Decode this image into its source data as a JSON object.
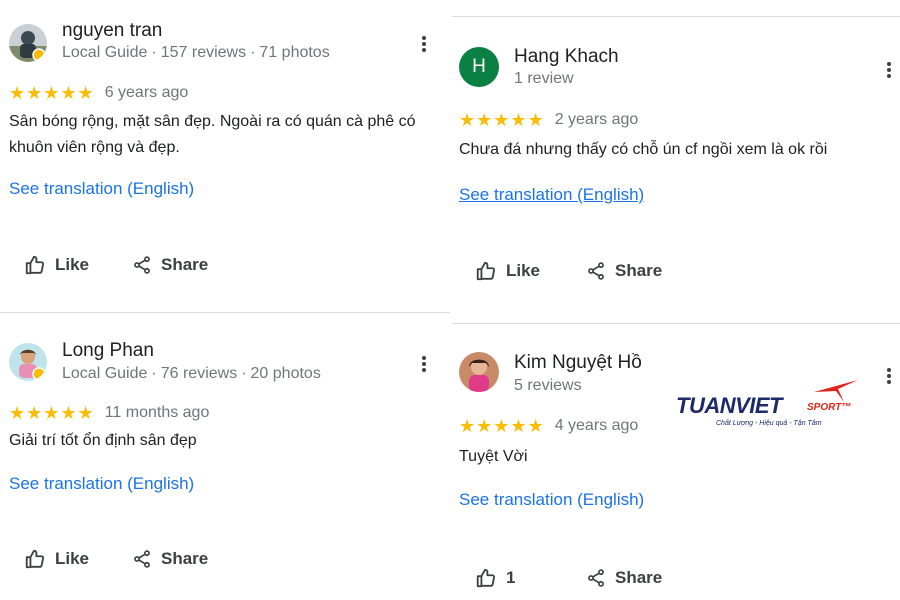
{
  "reviews": [
    {
      "name": "nguyen tran",
      "meta": [
        "Local Guide",
        "157 reviews",
        "71 photos"
      ],
      "stars": "★★★★★",
      "ago": "6 years ago",
      "text": "Sân bóng rộng, mặt sân đẹp. Ngoài ra có quán cà phê có khuôn viên rộng và đẹp.",
      "translate": "See translation (English)",
      "like": "Like",
      "share": "Share"
    },
    {
      "name": "Hang Khach",
      "avatar_letter": "H",
      "meta": [
        "1 review"
      ],
      "stars": "★★★★★",
      "ago": "2 years ago",
      "text": "Chưa đá nhưng thấy có chỗ ún cf ngồi xem là ok rồi",
      "translate": "See translation (English)",
      "like": "Like",
      "share": "Share"
    },
    {
      "name": "Long Phan",
      "meta": [
        "Local Guide",
        "76 reviews",
        "20 photos"
      ],
      "stars": "★★★★★",
      "ago": "11 months ago",
      "text": "Giải trí tốt ổn định sân đẹp",
      "translate": "See translation (English)",
      "like": "Like",
      "share": "Share"
    },
    {
      "name": "Kim Nguyệt Hồ",
      "meta": [
        "5 reviews"
      ],
      "stars": "★★★★★",
      "ago": "4 years ago",
      "text": "Tuyệt Vời",
      "translate": "See translation (English)",
      "like": "1",
      "share": "Share"
    }
  ],
  "meta_separator": "·",
  "logo": {
    "word": "TUANVIET",
    "sport": "SPORT™",
    "tagline": "Chất Lượng - Hiệu quả - Tận Tâm"
  },
  "colors": {
    "star": "#fbbc04",
    "link": "#1a73e8",
    "avatar_h": "#0b8043",
    "logo_navy": "#1b2a6b",
    "logo_red": "#e2231a"
  },
  "icons": [
    "more-vert-icon",
    "thumb-up-icon",
    "share-icon"
  ]
}
